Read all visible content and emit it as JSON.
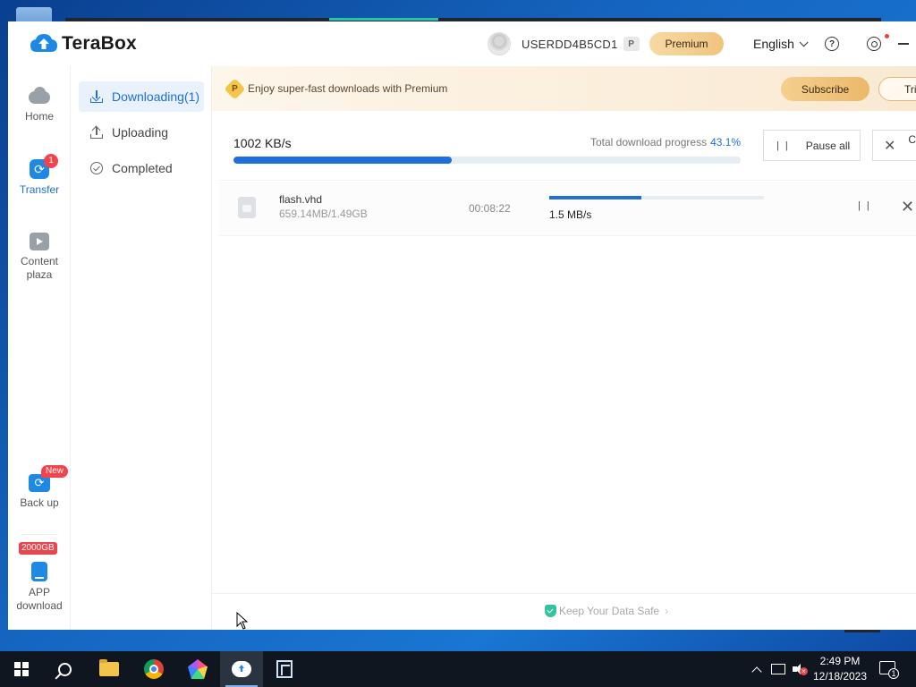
{
  "app": {
    "brand_name": "TeraBox",
    "username": "USERDD4B5CD1",
    "premium_label": "Premium",
    "language": "English",
    "help_glyph": "?",
    "p_badge": "P"
  },
  "leftnav": {
    "items": [
      {
        "label": "Home",
        "icon": "cloud-icon"
      },
      {
        "label": "Transfer",
        "icon": "transfer-icon",
        "badge": "1"
      },
      {
        "label": "Content plaza",
        "icon": "content-plaza-icon"
      },
      {
        "label": "Back up",
        "icon": "backup-icon",
        "badge": "New"
      },
      {
        "label": "APP download",
        "icon": "app-download-icon",
        "badge": "2000GB"
      }
    ]
  },
  "subnav": {
    "items": [
      {
        "label": "Downloading(1)",
        "active": true
      },
      {
        "label": "Uploading",
        "active": false
      },
      {
        "label": "Completed",
        "active": false
      }
    ]
  },
  "promo": {
    "badge": "P",
    "text": "Enjoy super-fast downloads with Premium",
    "subscribe_label": "Subscribe",
    "trial_label": "Trial"
  },
  "summary": {
    "speed": "1002 KB/s",
    "total_label": "Total download progress",
    "total_percent_text": "43.1%",
    "total_progress": 0.431,
    "pause_all_label": "Pause all",
    "cancel_all_label": "Cancel all"
  },
  "downloads": [
    {
      "name": "flash.vhd",
      "size": "659.14MB/1.49GB",
      "eta": "00:08:22",
      "speed": "1.5 MB/s",
      "progress": 0.431
    }
  ],
  "footer": {
    "text": "Keep Your Data Safe"
  },
  "taskbar": {
    "time": "2:49 PM",
    "date": "12/18/2023",
    "notifications": "1"
  },
  "colors": {
    "accent": "#1e6fd9",
    "premium_gold": "#f0c47f",
    "badge_red": "#f2444a"
  }
}
